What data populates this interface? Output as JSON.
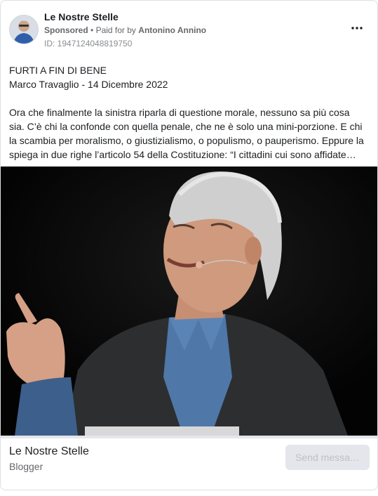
{
  "header": {
    "page_name": "Le Nostre Stelle",
    "sponsored_label": "Sponsored",
    "separator": "•",
    "paid_for_prefix": "Paid for by",
    "payer_name": "Antonino Annino",
    "ad_id": "ID: 1947124048819750",
    "more_icon": "more-horizontal-icon"
  },
  "post": {
    "title": "FURTI A FIN DI BENE",
    "byline": "Marco Travaglio - 14 Dicembre 2022",
    "body": "Ora che finalmente la sinistra riparla di questione morale, nessuno sa più cosa sia. C’è chi la confonde con quella penale, che ne è solo una mini-porzione. E chi la scambia per moralismo, o giustizialismo, o populismo, o pauperismo. Eppure la spiega in due righe l’articolo 54 della Costituzione: “I cittadini cui sono affidate…"
  },
  "footer": {
    "page_name": "Le Nostre Stelle",
    "category": "Blogger",
    "cta_label": "Send messa…"
  },
  "colors": {
    "secondary_text": "#65676b",
    "button_bg": "#e4e6eb",
    "button_text_disabled": "#bcc0c4",
    "image_background": "#050505"
  }
}
